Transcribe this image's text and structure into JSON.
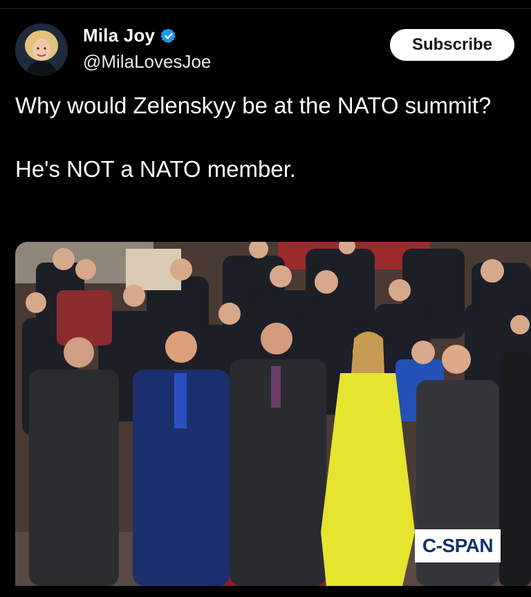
{
  "tweet": {
    "author": {
      "display_name": "Mila Joy",
      "handle": "@MilaLovesJoe",
      "verified": true,
      "verified_icon": "verified-badge-icon",
      "verified_color": "#1d9bf0"
    },
    "subscribe_label": "Subscribe",
    "text_line1": "Why would Zelenskyy be at the NATO summit?",
    "text_line2": "He's NOT a NATO member.",
    "media": {
      "kind": "video-still",
      "watermark": "C-SPAN"
    }
  },
  "colors": {
    "background": "#000000",
    "text": "#ffffff",
    "button_bg": "#ffffff",
    "button_text": "#0f1419"
  }
}
